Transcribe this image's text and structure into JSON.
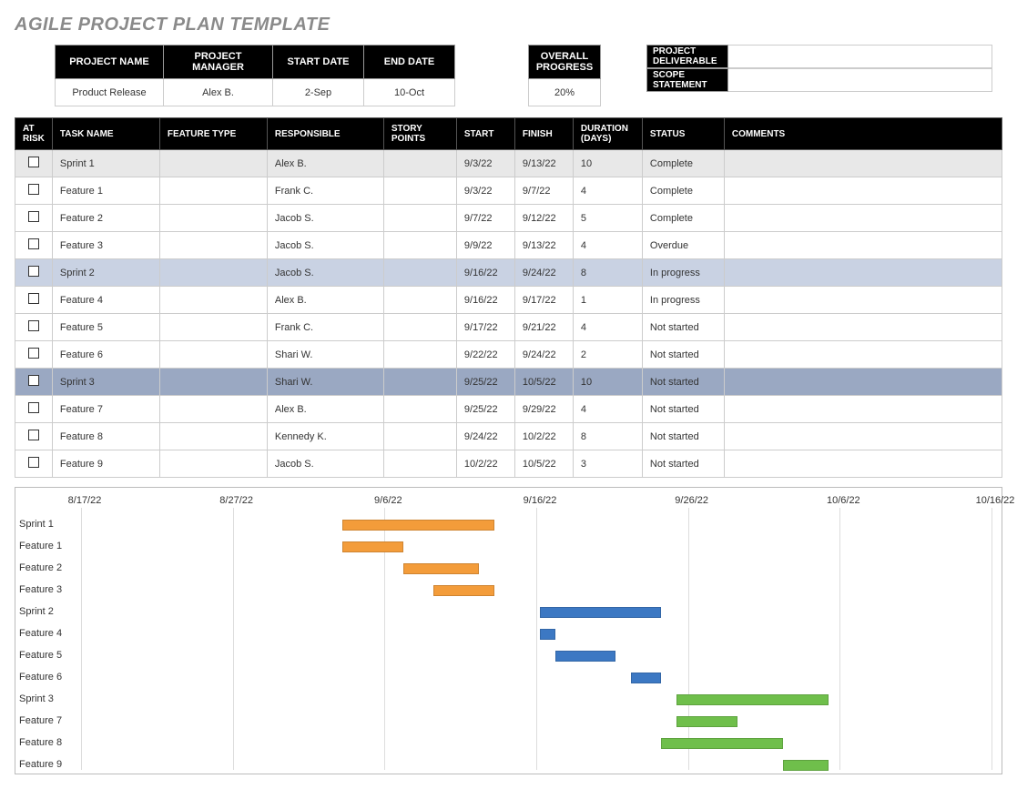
{
  "title": "AGILE PROJECT PLAN TEMPLATE",
  "summary": {
    "labels": {
      "project_name": "PROJECT NAME",
      "project_manager": "PROJECT MANAGER",
      "start": "START DATE",
      "end": "END DATE"
    },
    "values": {
      "project_name": "Product Release",
      "project_manager": "Alex B.",
      "start": "2-Sep",
      "end": "10-Oct"
    },
    "progress_label": "OVERALL PROGRESS",
    "progress_value": "20%",
    "deliverable_label": "PROJECT DELIVERABLE",
    "deliverable_value": "",
    "scope_label": "SCOPE STATEMENT",
    "scope_value": ""
  },
  "columns": {
    "risk": "AT RISK",
    "task": "TASK NAME",
    "feature": "FEATURE TYPE",
    "responsible": "RESPONSIBLE",
    "story": "STORY POINTS",
    "start": "START",
    "finish": "FINISH",
    "duration": "DURATION (DAYS)",
    "status": "STATUS",
    "comments": "COMMENTS"
  },
  "rows": [
    {
      "class": "sprint1",
      "task": "Sprint 1",
      "feature": "",
      "responsible": "Alex B.",
      "story": "",
      "start": "9/3/22",
      "finish": "9/13/22",
      "duration": "10",
      "status": "Complete",
      "comments": ""
    },
    {
      "class": "",
      "task": "Feature 1",
      "feature": "",
      "responsible": "Frank C.",
      "story": "",
      "start": "9/3/22",
      "finish": "9/7/22",
      "duration": "4",
      "status": "Complete",
      "comments": ""
    },
    {
      "class": "",
      "task": "Feature 2",
      "feature": "",
      "responsible": "Jacob S.",
      "story": "",
      "start": "9/7/22",
      "finish": "9/12/22",
      "duration": "5",
      "status": "Complete",
      "comments": ""
    },
    {
      "class": "",
      "task": "Feature 3",
      "feature": "",
      "responsible": "Jacob S.",
      "story": "",
      "start": "9/9/22",
      "finish": "9/13/22",
      "duration": "4",
      "status": "Overdue",
      "comments": ""
    },
    {
      "class": "sprint2",
      "task": "Sprint 2",
      "feature": "",
      "responsible": "Jacob S.",
      "story": "",
      "start": "9/16/22",
      "finish": "9/24/22",
      "duration": "8",
      "status": "In progress",
      "comments": ""
    },
    {
      "class": "",
      "task": "Feature 4",
      "feature": "",
      "responsible": "Alex B.",
      "story": "",
      "start": "9/16/22",
      "finish": "9/17/22",
      "duration": "1",
      "status": "In progress",
      "comments": ""
    },
    {
      "class": "",
      "task": "Feature 5",
      "feature": "",
      "responsible": "Frank C.",
      "story": "",
      "start": "9/17/22",
      "finish": "9/21/22",
      "duration": "4",
      "status": "Not started",
      "comments": ""
    },
    {
      "class": "",
      "task": "Feature 6",
      "feature": "",
      "responsible": "Shari W.",
      "story": "",
      "start": "9/22/22",
      "finish": "9/24/22",
      "duration": "2",
      "status": "Not started",
      "comments": ""
    },
    {
      "class": "sprint3",
      "task": "Sprint 3",
      "feature": "",
      "responsible": "Shari W.",
      "story": "",
      "start": "9/25/22",
      "finish": "10/5/22",
      "duration": "10",
      "status": "Not started",
      "comments": ""
    },
    {
      "class": "",
      "task": "Feature 7",
      "feature": "",
      "responsible": "Alex B.",
      "story": "",
      "start": "9/25/22",
      "finish": "9/29/22",
      "duration": "4",
      "status": "Not started",
      "comments": ""
    },
    {
      "class": "",
      "task": "Feature 8",
      "feature": "",
      "responsible": "Kennedy K.",
      "story": "",
      "start": "9/24/22",
      "finish": "10/2/22",
      "duration": "8",
      "status": "Not started",
      "comments": ""
    },
    {
      "class": "",
      "task": "Feature 9",
      "feature": "",
      "responsible": "Jacob S.",
      "story": "",
      "start": "10/2/22",
      "finish": "10/5/22",
      "duration": "3",
      "status": "Not started",
      "comments": ""
    }
  ],
  "chart_data": {
    "type": "gantt",
    "x_ticks": [
      "8/17/22",
      "8/27/22",
      "9/6/22",
      "9/16/22",
      "9/26/22",
      "10/6/22",
      "10/16/22"
    ],
    "x_min": "8/17/22",
    "x_max": "10/16/22",
    "tasks": [
      {
        "name": "Sprint 1",
        "start": "9/3/22",
        "finish": "9/13/22",
        "color": "orange"
      },
      {
        "name": "Feature 1",
        "start": "9/3/22",
        "finish": "9/7/22",
        "color": "orange"
      },
      {
        "name": "Feature 2",
        "start": "9/7/22",
        "finish": "9/12/22",
        "color": "orange"
      },
      {
        "name": "Feature 3",
        "start": "9/9/22",
        "finish": "9/13/22",
        "color": "orange"
      },
      {
        "name": "Sprint 2",
        "start": "9/16/22",
        "finish": "9/24/22",
        "color": "blue"
      },
      {
        "name": "Feature 4",
        "start": "9/16/22",
        "finish": "9/17/22",
        "color": "blue"
      },
      {
        "name": "Feature 5",
        "start": "9/17/22",
        "finish": "9/21/22",
        "color": "blue"
      },
      {
        "name": "Feature 6",
        "start": "9/22/22",
        "finish": "9/24/22",
        "color": "blue"
      },
      {
        "name": "Sprint 3",
        "start": "9/25/22",
        "finish": "10/5/22",
        "color": "green"
      },
      {
        "name": "Feature 7",
        "start": "9/25/22",
        "finish": "9/29/22",
        "color": "green"
      },
      {
        "name": "Feature 8",
        "start": "9/24/22",
        "finish": "10/2/22",
        "color": "green"
      },
      {
        "name": "Feature 9",
        "start": "10/2/22",
        "finish": "10/5/22",
        "color": "green"
      }
    ]
  }
}
